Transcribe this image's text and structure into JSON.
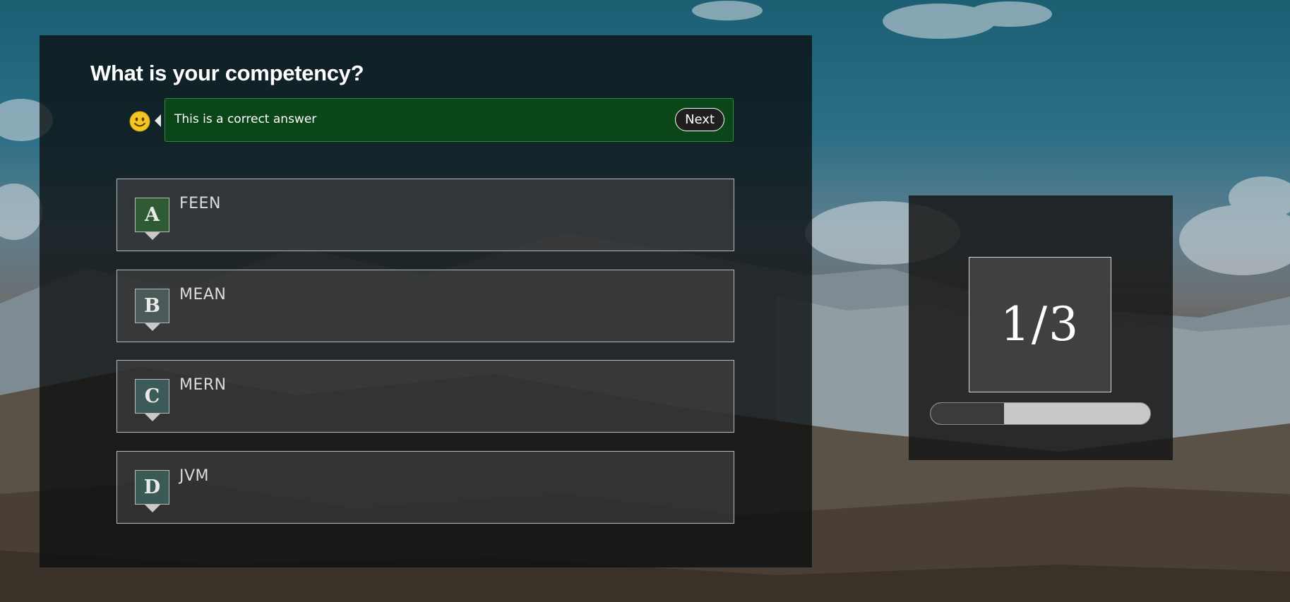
{
  "quiz": {
    "question": "What is your competency?",
    "feedback": {
      "message": "This is a correct answer",
      "next_label": "Next"
    },
    "options": [
      {
        "letter": "A",
        "label": "FEEN",
        "badge_color": "#2e5a34"
      },
      {
        "letter": "B",
        "label": "MEAN",
        "badge_color": "#4a5a58"
      },
      {
        "letter": "C",
        "label": "MERN",
        "badge_color": "#3c5a58"
      },
      {
        "letter": "D",
        "label": "JVM",
        "badge_color": "#3a5a56"
      }
    ]
  },
  "progress": {
    "counter": "1/3",
    "fraction": 0.333
  },
  "colors": {
    "feedback_bg": "#0b4619",
    "panel_bg": "#0a0e10"
  }
}
